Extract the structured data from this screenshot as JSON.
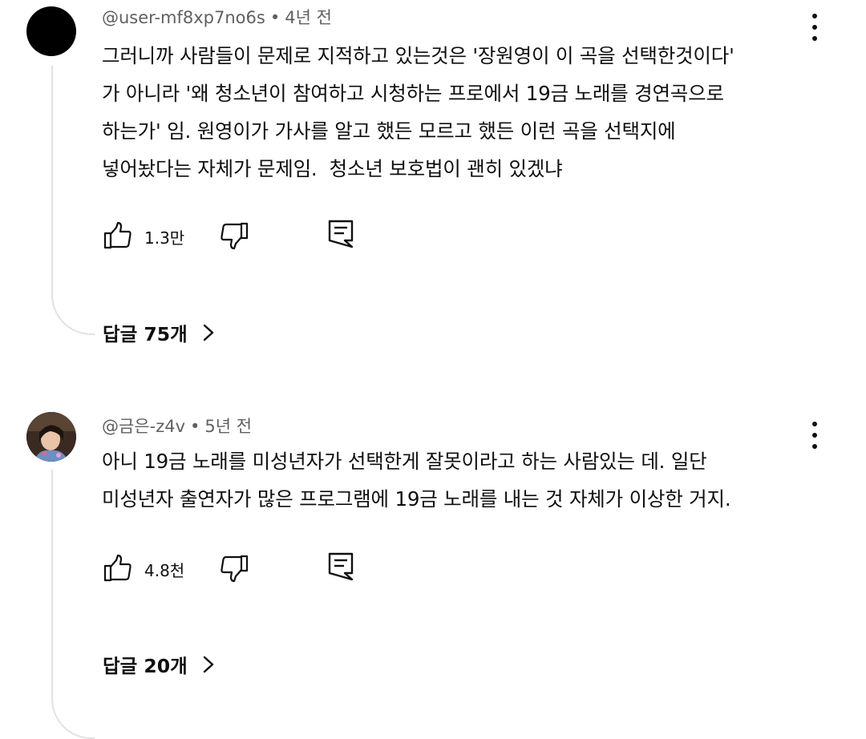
{
  "comments": [
    {
      "author": "@user-mf8xp7no6s",
      "separator": "•",
      "time": "4년 전",
      "text": "그러니까 사람들이 문제로 지적하고 있는것은 '장원영이 이 곡을 선택한것이다'\n가 아니라 '왜 청소년이 참여하고 시청하는 프로에서 19금 노래를 경연곡으로\n하는가' 임. 원영이가 가사를 알고 했든 모르고 했든 이런 곡을 선택지에\n넣어놨다는 자체가 문제임.  청소년 보호법이 괜히 있겠냐",
      "likes": "1.3만",
      "replies_label": "답글 75개",
      "avatar_color": "#000000"
    },
    {
      "author": "@금은-z4v",
      "separator": "•",
      "time": "5년 전",
      "text": "아니 19금 노래를 미성년자가 선택한게 잘못이라고 하는 사람있는 데. 일단\n미성년자 출연자가 많은 프로그램에 19금 노래를 내는 것 자체가 이상한 거지.",
      "likes": "4.8천",
      "replies_label": "답글 20개",
      "avatar_color": "#3a2a22"
    }
  ],
  "icons": {
    "like": "thumbs-up-icon",
    "dislike": "thumbs-down-icon",
    "reply": "reply-comment-icon",
    "more": "more-vertical-icon",
    "chevron": "chevron-right-icon"
  }
}
